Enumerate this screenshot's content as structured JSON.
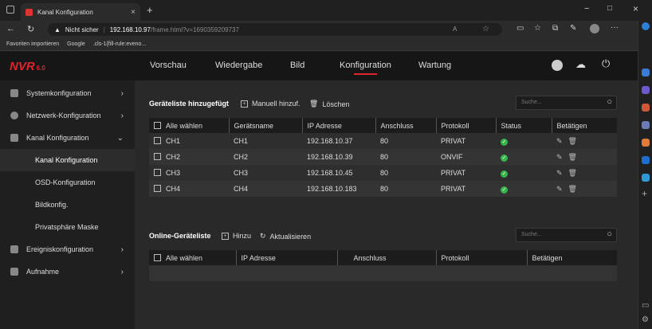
{
  "browser": {
    "tab_title": "Kanal Konfiguration",
    "tab_close": "×",
    "new_tab": "+",
    "security_label": "Nicht sicher",
    "url_host": "192.168.10.97",
    "url_path": "/frame.html?v=1690359209737",
    "favorites": [
      "Favoriten importieren",
      "Google",
      ".cls-1{fill-rule:eveno..."
    ],
    "window_controls": [
      "−",
      "□",
      "×"
    ]
  },
  "nvr": {
    "logo": "NVR",
    "version": "6.0",
    "nav": [
      "Vorschau",
      "Wiedergabe",
      "Bild",
      "Konfiguration",
      "Wartung"
    ],
    "active_nav": "Konfiguration",
    "sidebar": [
      {
        "label": "Systemkonfiguration",
        "chevron": "›"
      },
      {
        "label": "Netzwerk-Konfiguration",
        "chevron": "›"
      },
      {
        "label": "Kanal Konfiguration",
        "chevron": "⌄"
      },
      {
        "label": "Kanal Konfiguration"
      },
      {
        "label": "OSD-Konfiguration"
      },
      {
        "label": "Bildkonfig."
      },
      {
        "label": "Privatsphäre Maske"
      },
      {
        "label": "Ereigniskonfiguration",
        "chevron": "›"
      },
      {
        "label": "Aufnahme",
        "chevron": "›"
      }
    ],
    "device_list": {
      "title": "Geräteliste hinzugefügt",
      "manual_add": "Manuell hinzuf.",
      "delete": "Löschen",
      "search_placeholder": "Suche...",
      "headers": [
        "Alle wählen",
        "Gerätsname",
        "IP Adresse",
        "Anschluss",
        "Protokoll",
        "Status",
        "Betätigen"
      ],
      "rows": [
        {
          "ch": "CH1",
          "name": "CH1",
          "ip": "192.168.10.37",
          "port": "80",
          "protocol": "PRIVAT",
          "status": "ok"
        },
        {
          "ch": "CH2",
          "name": "CH2",
          "ip": "192.168.10.39",
          "port": "80",
          "protocol": "ONVIF",
          "status": "ok"
        },
        {
          "ch": "CH3",
          "name": "CH3",
          "ip": "192.168.10.45",
          "port": "80",
          "protocol": "PRIVAT",
          "status": "ok"
        },
        {
          "ch": "CH4",
          "name": "CH4",
          "ip": "192.168.10.183",
          "port": "80",
          "protocol": "PRIVAT",
          "status": "ok"
        }
      ]
    },
    "online_list": {
      "title": "Online-Geräteliste",
      "add": "Hinzu",
      "refresh": "Aktualisieren",
      "search_placeholder": "Suche...",
      "headers": [
        "Alle wählen",
        "IP Adresse",
        "Anschluss",
        "Protokoll",
        "Betätigen"
      ]
    }
  }
}
